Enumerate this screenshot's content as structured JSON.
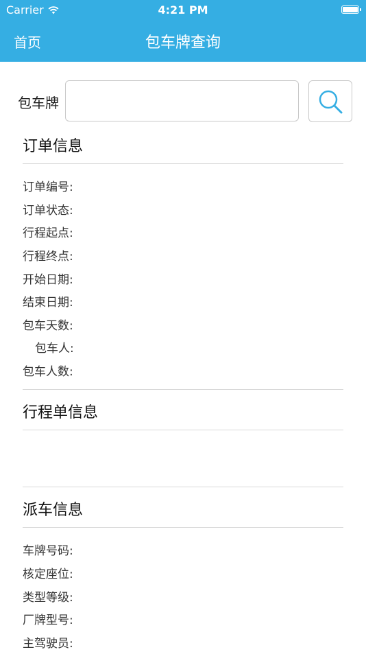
{
  "status_bar": {
    "carrier": "Carrier",
    "time": "4:21 PM"
  },
  "nav": {
    "back_label": "首页",
    "title": "包车牌查询"
  },
  "search": {
    "label": "包车牌",
    "value": "",
    "placeholder": ""
  },
  "order_info": {
    "title": "订单信息",
    "fields": [
      "订单编号:",
      "订单状态:",
      "行程起点:",
      "行程终点:",
      "开始日期:",
      "结束日期:",
      "包车天数:",
      "包车人:",
      "包车人数:"
    ]
  },
  "itinerary_info": {
    "title": "行程单信息"
  },
  "dispatch_info": {
    "title": "派车信息",
    "fields": [
      "车牌号码:",
      "核定座位:",
      "类型等级:",
      "厂牌型号:",
      "主驾驶员:"
    ]
  },
  "colors": {
    "accent": "#35aee3",
    "divider": "#d8d8d8"
  }
}
